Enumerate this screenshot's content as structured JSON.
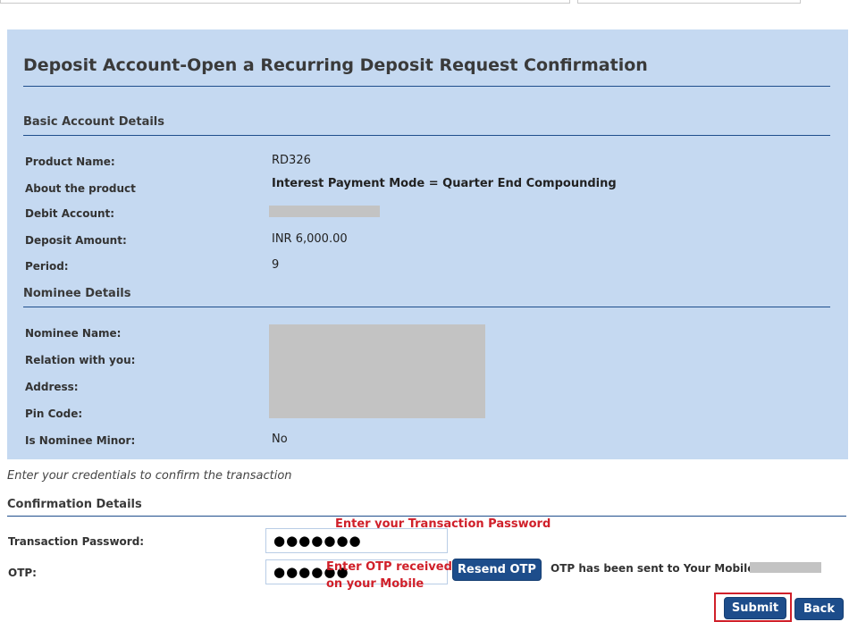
{
  "page": {
    "title": "Deposit Account-Open a Recurring Deposit Request Confirmation"
  },
  "basic_details": {
    "section_title": "Basic Account Details",
    "rows": [
      {
        "label": "Product Name:",
        "value": "RD326"
      },
      {
        "label": "About the product",
        "value": "Interest Payment Mode = Quarter End Compounding"
      },
      {
        "label": "Debit Account:",
        "value": ""
      },
      {
        "label": "Deposit Amount:",
        "value": "INR 6,000.00"
      },
      {
        "label": "Period:",
        "value": "9"
      }
    ]
  },
  "nominee_details": {
    "section_title": "Nominee Details",
    "rows": [
      {
        "label": "Nominee Name:"
      },
      {
        "label": "Relation with you:"
      },
      {
        "label": "Address:"
      },
      {
        "label": "Pin Code:"
      },
      {
        "label": "Is Nominee Minor:",
        "value": "No"
      }
    ]
  },
  "credentials": {
    "intro": "Enter your credentials to confirm the transaction",
    "section_title": "Confirmation Details",
    "password_label": "Transaction Password:",
    "password_value": "●●●●●●●",
    "password_hint": "Enter your Transaction Password",
    "otp_label": "OTP:",
    "otp_value": "●●●●●●",
    "otp_hint_line1": "Enter OTP received",
    "otp_hint_line2": "on your Mobile",
    "resend_label": "Resend OTP",
    "otp_message": "OTP has been sent to Your Mobile No"
  },
  "actions": {
    "submit_label": "Submit",
    "back_label": "Back"
  },
  "colors": {
    "panel_bg": "#c5d9f1",
    "accent": "#1d4d8b",
    "annotation": "#d0202a"
  }
}
